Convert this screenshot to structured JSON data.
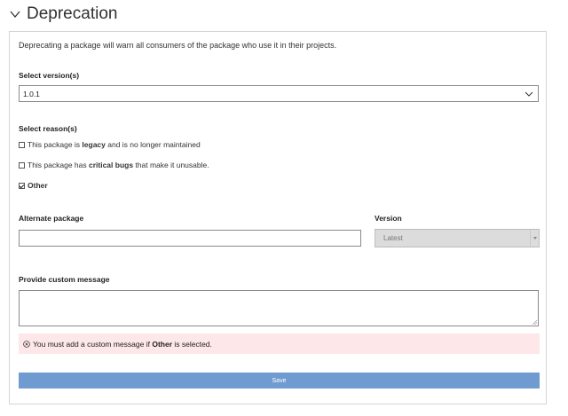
{
  "header": {
    "title": "Deprecation"
  },
  "intro": "Deprecating a package will warn all consumers of the package who use it in their projects.",
  "versions": {
    "label": "Select version(s)",
    "selected": "1.0.1"
  },
  "reasons": {
    "label": "Select reason(s)",
    "legacy": {
      "pre": "This package is ",
      "bold": "legacy",
      "post": " and is no longer maintained",
      "checked": false
    },
    "critical": {
      "pre": "This package has ",
      "bold": "critical bugs",
      "post": " that make it unusable.",
      "checked": false
    },
    "other": {
      "label": "Other",
      "checked": true
    }
  },
  "alternate": {
    "label": "Alternate package",
    "value": ""
  },
  "alt_version": {
    "label": "Version",
    "selected": "Latest"
  },
  "custom_message": {
    "label": "Provide custom message",
    "value": ""
  },
  "error": {
    "pre": "You must add a custom message if ",
    "bold": "Other",
    "post": " is selected."
  },
  "save_label": "Save",
  "colors": {
    "error_bg": "#fde7e9",
    "save_bg": "#6f9bd1",
    "disabled_bg": "#dcdcdc"
  },
  "icons": {
    "collapse": "chevron-down-icon",
    "dropdown": "chevron-down-icon",
    "error": "error-circle-icon"
  }
}
